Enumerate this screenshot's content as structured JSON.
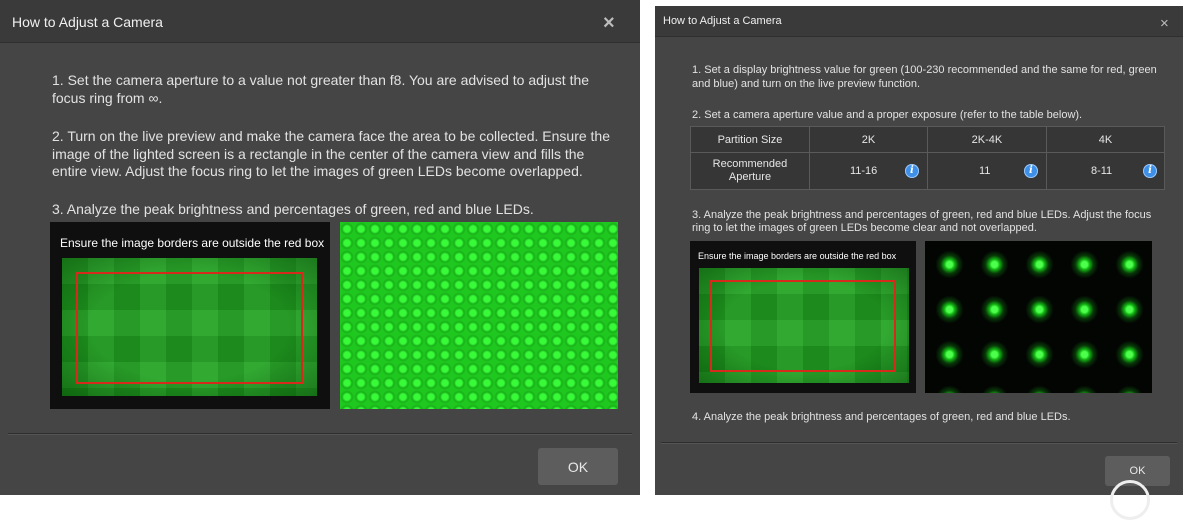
{
  "left_dialog": {
    "title": "How to Adjust a Camera",
    "close_glyph": "×",
    "steps": [
      "1. Set the camera aperture to a value not greater than f8. You are advised to adjust the focus ring from ∞.",
      "2. Turn on the live preview and make the camera face the area to be collected. Ensure the image of the lighted screen is a rectangle in the center of the camera view and fills the entire view. Adjust the focus ring to let the images of green LEDs become overlapped.",
      "3. Analyze the peak brightness and percentages of green, red and blue LEDs."
    ],
    "image_caption": "Ensure the image borders are outside the red box",
    "ok_label": "OK"
  },
  "right_dialog": {
    "title": "How to Adjust a Camera",
    "close_glyph": "×",
    "steps": [
      "1. Set a display brightness value for green (100-230 recommended and the same for red, green and blue) and turn on the live preview function.",
      "2. Set a camera aperture value and a proper exposure (refer to the table below).",
      "3. Analyze the peak brightness and percentages of green, red and blue LEDs. Adjust the focus ring to let the images of green LEDs become clear and not overlapped.",
      "4. Analyze the peak brightness and percentages of green, red and blue LEDs."
    ],
    "table": {
      "header_label": "Partition Size",
      "columns": [
        "2K",
        "2K-4K",
        "4K"
      ],
      "row_label": "Recommended Aperture",
      "values": [
        "11-16",
        "11",
        "8-11"
      ],
      "info_glyph": "i"
    },
    "image_caption": "Ensure the image borders are outside the red box",
    "ok_label": "OK"
  },
  "colors": {
    "dialog_bg": "#454545",
    "titlebar_bg": "#3a3a3a",
    "led_green": "#21a321",
    "red_box": "#d62a1c",
    "info_blue": "#3d8fe8"
  },
  "icons": [
    "close-icon",
    "info-icon"
  ]
}
